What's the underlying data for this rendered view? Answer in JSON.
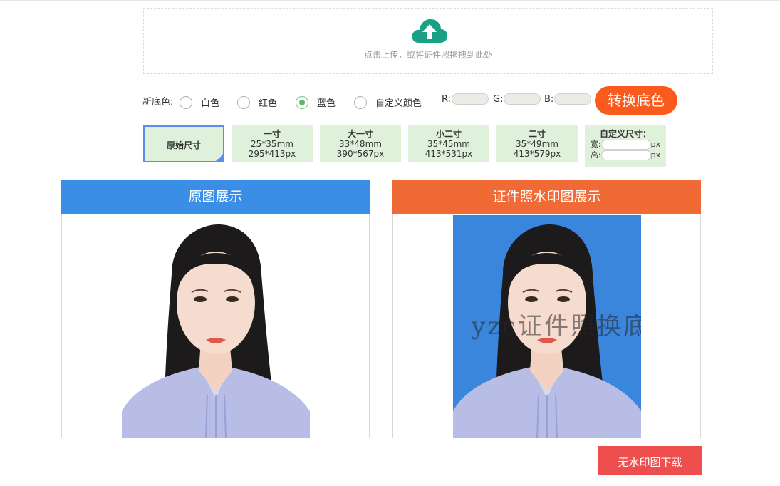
{
  "upload": {
    "hint": "点击上传，或将证件照拖拽到此处",
    "icon": "cloud-upload-icon",
    "icon_color": "#1aa082"
  },
  "background": {
    "label": "新底色:",
    "options": [
      "白色",
      "红色",
      "蓝色",
      "自定义颜色"
    ],
    "selected": "蓝色",
    "r_label": "R:",
    "g_label": "G:",
    "b_label": "B:",
    "convert_button": "转换底色",
    "convert_color": "#fb5a1d"
  },
  "sizes": {
    "original": "原始尺寸",
    "presets": [
      {
        "name": "一寸",
        "mm": "25*35mm",
        "px": "295*413px"
      },
      {
        "name": "大一寸",
        "mm": "33*48mm",
        "px": "390*567px"
      },
      {
        "name": "小二寸",
        "mm": "35*45mm",
        "px": "413*531px"
      },
      {
        "name": "二寸",
        "mm": "35*49mm",
        "px": "413*579px"
      }
    ],
    "custom_title": "自定义尺寸：",
    "width_label": "宽:",
    "height_label": "高:",
    "unit": "px"
  },
  "panels": {
    "original_title": "原图展示",
    "watermark_title": "证件照水印图展示",
    "watermark_text": "yzc证件照换底",
    "original_header_color": "#3a8ee6",
    "watermark_header_color": "#f06a35",
    "photo_bg_color": "#3a86dd"
  },
  "download_button": "无水印图下载",
  "download_color": "#ef4e4e"
}
